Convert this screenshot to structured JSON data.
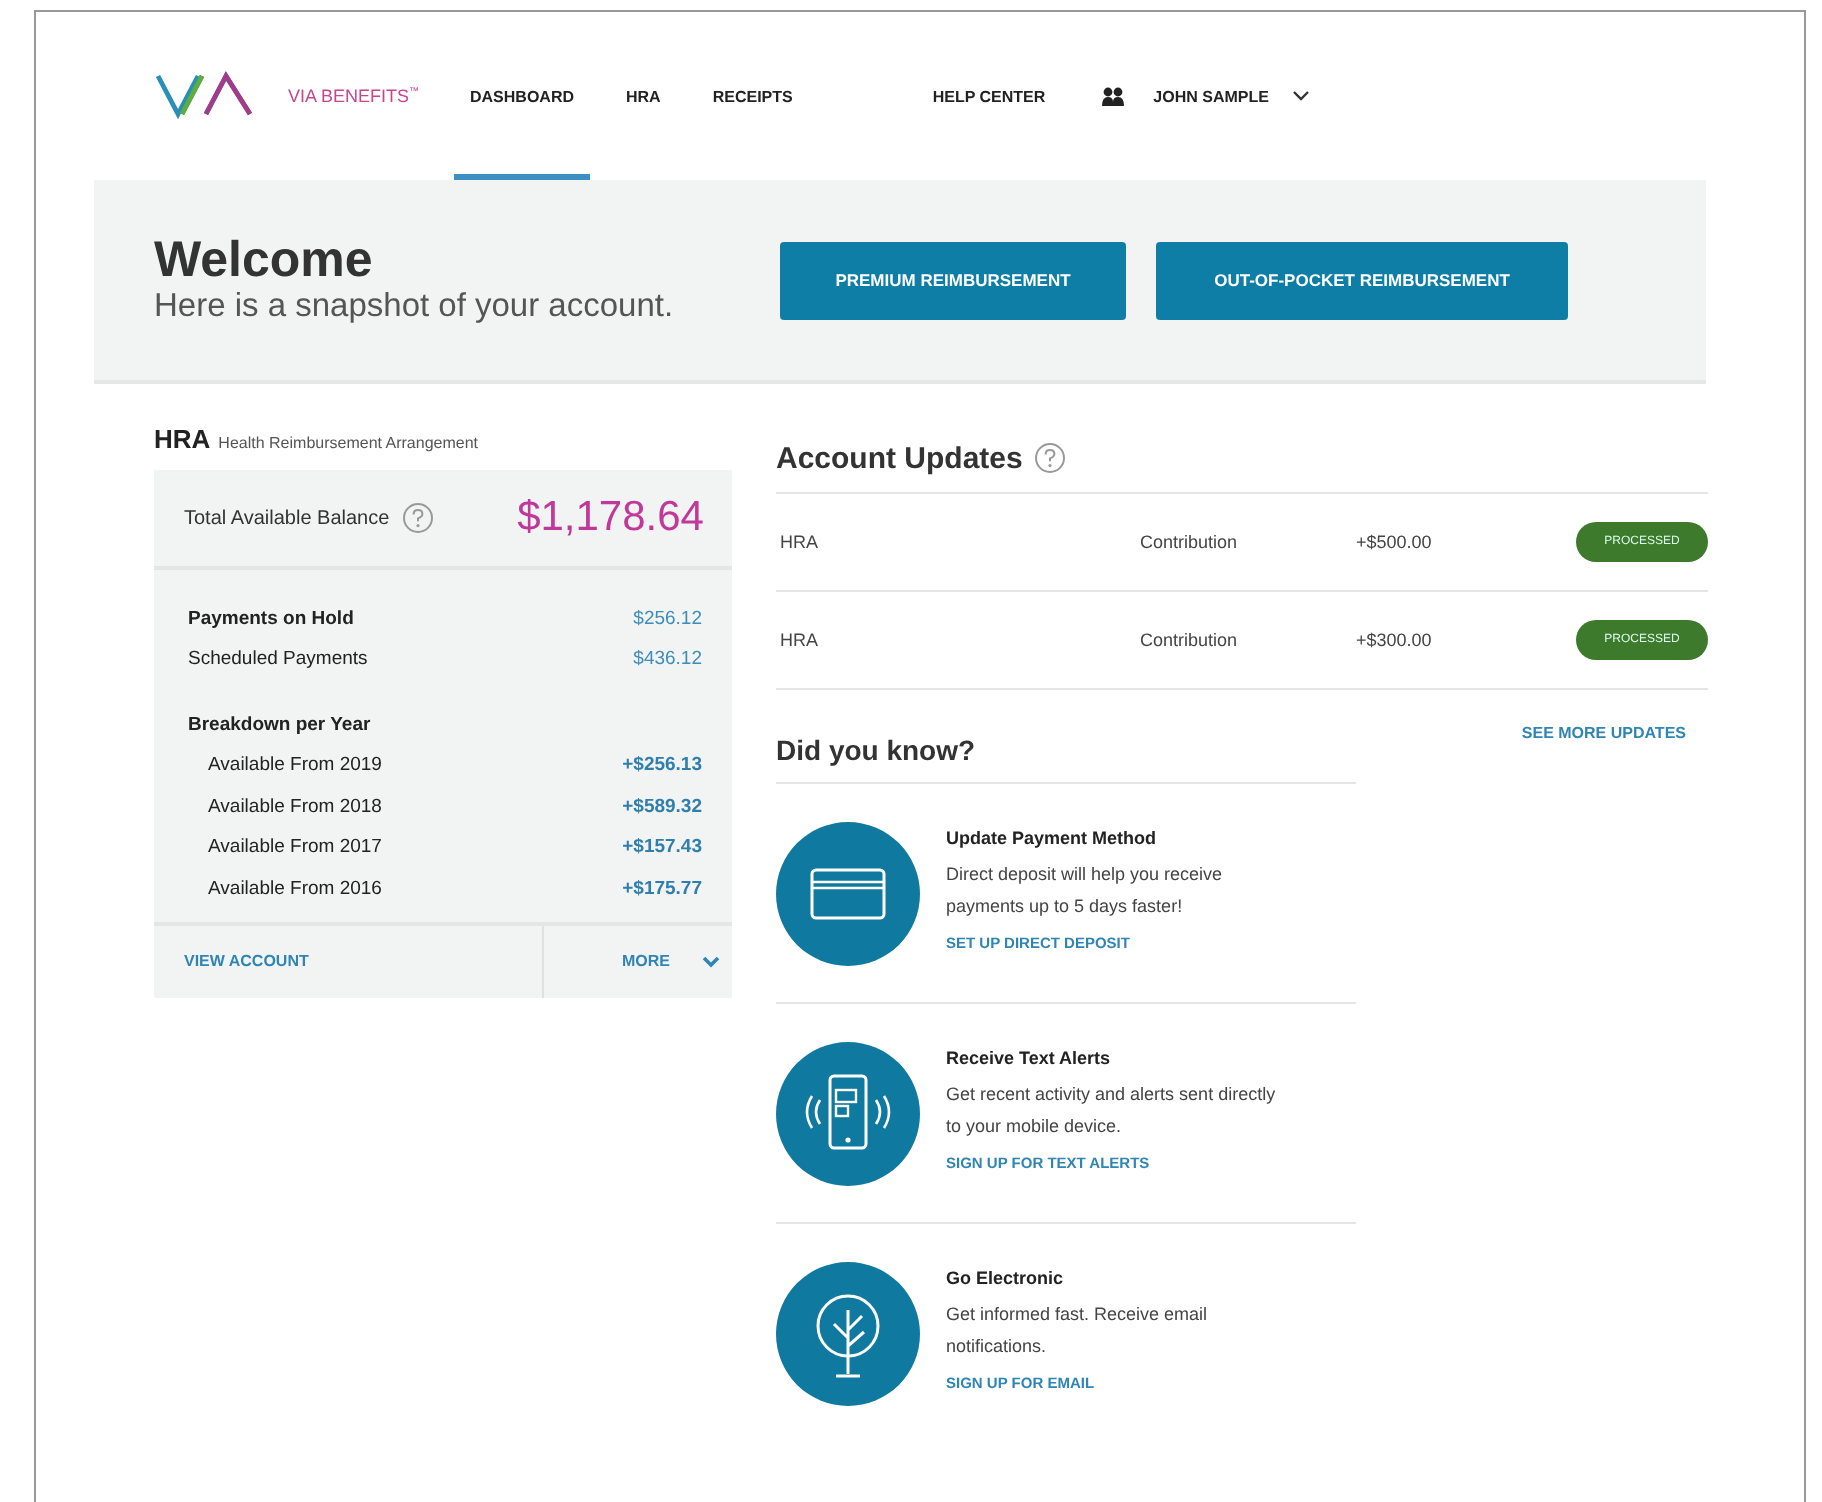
{
  "brand": {
    "name": "VIA BENEFITS",
    "mark": "™"
  },
  "nav": [
    {
      "label": "DASHBOARD",
      "selected": true
    },
    {
      "label": "HRA",
      "selected": false
    },
    {
      "label": "RECEIPTS",
      "selected": false
    }
  ],
  "help": "HELP CENTER",
  "user": {
    "name": "JOHN SAMPLE"
  },
  "welcome": {
    "title": "Welcome",
    "subtitle": "Here is a snapshot of your account.",
    "buttons": [
      "PREMIUM REIMBURSEMENT",
      "OUT-OF-POCKET REIMBURSEMENT"
    ]
  },
  "hra": {
    "title": "HRA",
    "subtitle": "Health Reimbursement Arrangement",
    "balance_label": "Total Available Balance",
    "balance": "$1,178.64",
    "payments": [
      {
        "label": "Payments on Hold",
        "value": "$256.12",
        "bold": true
      },
      {
        "label": "Scheduled Payments",
        "value": "$436.12",
        "bold": false
      }
    ],
    "breakdown_title": "Breakdown per Year",
    "breakdown": [
      {
        "label": "Available From 2019",
        "value": "+$256.13"
      },
      {
        "label": "Available From 2018",
        "value": "+$589.32"
      },
      {
        "label": "Available From 2017",
        "value": "+$157.43"
      },
      {
        "label": "Available From 2016",
        "value": "+$175.77"
      }
    ],
    "view_link": "VIEW ACCOUNT",
    "more": "MORE"
  },
  "updates": {
    "title": "Account Updates",
    "rows": [
      {
        "account": "HRA",
        "type": "Contribution",
        "amount": "+$500.00",
        "status": "PROCESSED"
      },
      {
        "account": "HRA",
        "type": "Contribution",
        "amount": "+$300.00",
        "status": "PROCESSED"
      }
    ],
    "more_link": "SEE MORE UPDATES"
  },
  "tips": {
    "title": "Did you know?",
    "items": [
      {
        "kind": "card",
        "title": "Update Payment Method",
        "text": "Direct deposit will help you receive payments up to 5 days faster!",
        "link": "SET UP DIRECT DEPOSIT"
      },
      {
        "kind": "phone",
        "title": "Receive Text Alerts",
        "text": "Get recent activity and alerts sent directly to your mobile device.",
        "link": "SIGN UP FOR TEXT ALERTS"
      },
      {
        "kind": "tree",
        "title": "Go Electronic",
        "text": "Get informed fast. Receive email notifications.",
        "link": "SIGN UP FOR EMAIL"
      }
    ]
  }
}
